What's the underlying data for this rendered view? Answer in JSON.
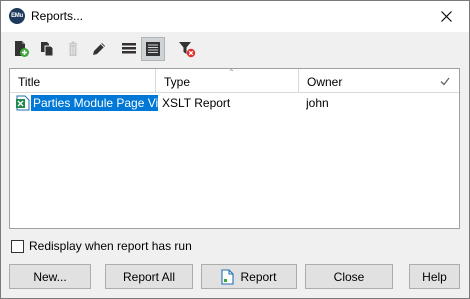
{
  "window": {
    "title": "Reports...",
    "app_icon_text": "EMu"
  },
  "toolbar": {
    "buttons": [
      {
        "icon": "new-report-icon"
      },
      {
        "icon": "copy-report-icon"
      },
      {
        "icon": "delete-report-icon",
        "disabled": true
      },
      {
        "icon": "edit-report-icon"
      },
      {
        "icon": "list-view-icon"
      },
      {
        "icon": "details-view-icon",
        "active": true
      },
      {
        "icon": "clear-filter-icon"
      }
    ]
  },
  "grid": {
    "columns": [
      "Title",
      "Type",
      "Owner"
    ],
    "rows": [
      {
        "title": "Parties Module Page Vi...",
        "type": "XSLT Report",
        "owner": "john",
        "selected": true
      }
    ]
  },
  "options": {
    "redisplay_label": "Redisplay when report has run",
    "redisplay_checked": false
  },
  "buttons": {
    "new": "New...",
    "report_all": "Report All",
    "report": "Report",
    "close": "Close",
    "help": "Help"
  },
  "colors": {
    "selection": "#0078d7",
    "dialog_bg": "#f0f0f0",
    "add_green": "#3aa935",
    "filter_red": "#e0302f"
  }
}
